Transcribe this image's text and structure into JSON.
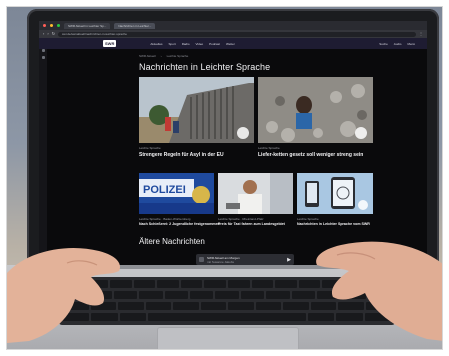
{
  "browser": {
    "tabs": [
      "SWR Aktuell in Leichter Sp...",
      "Nachrichten in Leichter..."
    ],
    "address": "swr.de/swraktuell/nachrichten-in-leichter-sprache"
  },
  "site": {
    "logo": "SWR",
    "nav": [
      "Aktuelles",
      "Sport",
      "Radio",
      "Video",
      "Podcast",
      "Wetter"
    ],
    "header_right": [
      "Suche",
      "Audio",
      "Menü"
    ],
    "breadcrumb": [
      "SWR Aktuell",
      "Leichte Sprache"
    ],
    "page_title": "Nachrichten in Leichter Sprache",
    "featured": [
      {
        "meta": "Leichte Sprache",
        "title": "Strengere Regeln für Asyl in der EU"
      },
      {
        "meta": "Leichte Sprache",
        "title": "Liefer-ketten gesetz soll weniger streng sein"
      }
    ],
    "cards": [
      {
        "meta": "Leichte Sprache · Baden-Württemberg",
        "title": "Nach Schießerei: 2 Jugendliche festgenommen"
      },
      {
        "meta": "Leichte Sprache · Rheinland-Pfalz",
        "title": "Preis für Taxi fahren zum Landesgebiet"
      },
      {
        "meta": "Leichte Sprache",
        "title": "Nachrichten in Leichter Sprache vom SWR"
      }
    ],
    "older_title": "Ältere Nachrichten",
    "audio_player": {
      "title": "SWR Aktuell am Morgen",
      "subtitle": "mit Susanne Jakobs"
    }
  },
  "image_text": {
    "police_sign": "POLIZEI"
  },
  "colors": {
    "header": "#1e1c32",
    "page_bg": "#0a0a0c",
    "laptop_base": "#c7c8cb"
  }
}
